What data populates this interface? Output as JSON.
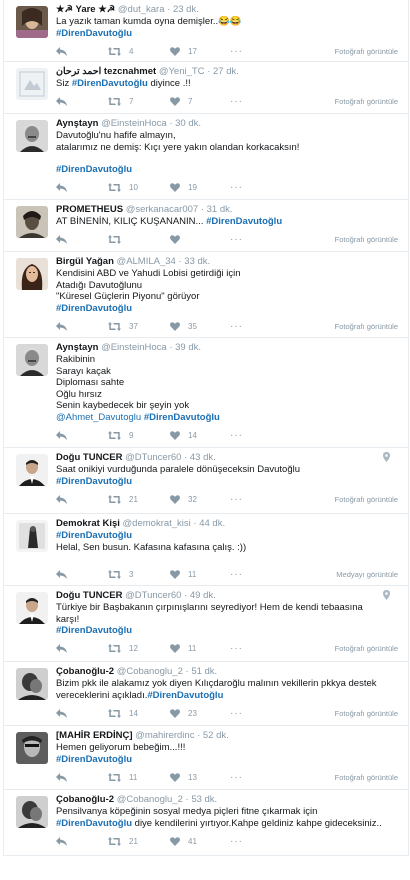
{
  "colors": {
    "accent": "#1b6fb3",
    "muted": "#8899a6",
    "text": "#14171a",
    "border": "#e6ecf0"
  },
  "tweets": [
    {
      "name": "★☭ Yare ★☭",
      "handle": "@dut_kara",
      "time": "· 23 dk.",
      "lines": [
        "La yazık taman kumda oyna demişler..😂😂"
      ],
      "tags": "#DirenDavutoğlu",
      "retweets": "4",
      "likes": "17",
      "media": "Fotoğrafı görüntüle",
      "avatar": "a1"
    },
    {
      "name": "احمد ترحان tezcnahmet",
      "handle": "@Yeni_TC",
      "time": "· 27 dk.",
      "lines_prefix": "Siz ",
      "inline_tag": "#DirenDavutoğlu",
      "lines_suffix": " diyince .!!",
      "retweets": "7",
      "likes": "7",
      "media": "Fotoğrafı görüntüle",
      "avatar": "a2"
    },
    {
      "name": "Aynştayn",
      "handle": "@EinsteinHoca",
      "time": "· 30 dk.",
      "lines": [
        "Davutoğlu'nu hafife almayın,",
        "atalarımız ne demiş: Kıçı yere yakın olandan korkacaksın!"
      ],
      "tags": "#DirenDavutoğlu",
      "retweets": "10",
      "likes": "19",
      "avatar": "a3"
    },
    {
      "name": "PROMETHEUS",
      "handle": "@serkanacar007",
      "time": "· 31 dk.",
      "lines_prefix": "AT BİNENİN, KILIÇ KUŞANANIN... ",
      "inline_tag": "#DirenDavutoğlu",
      "lines_suffix": "",
      "retweets": "",
      "likes": "",
      "media": "Fotoğrafı görüntüle",
      "avatar": "a4"
    },
    {
      "name": "Birgül Yağan",
      "handle": "@ALMILA_34",
      "time": "· 33 dk.",
      "lines": [
        "Kendisini ABD ve Yahudi Lobisi getirdiği için",
        "Atadığı Davutoğlunu",
        "\"Küresel Güçlerin Piyonu\" görüyor"
      ],
      "tags": "#DirenDavutoğlu",
      "retweets": "37",
      "likes": "35",
      "media": "Fotoğrafı görüntüle",
      "avatar": "a5"
    },
    {
      "name": "Aynştayn",
      "handle": "@EinsteinHoca",
      "time": "· 39 dk.",
      "lines": [
        "Rakibinin",
        "Sarayı kaçak",
        "Diploması sahte",
        "Oğlu hırsız",
        "Senin kaybedecek bir şeyin yok"
      ],
      "mention": "@Ahmet_Davutoglu",
      "tags": "#DirenDavutoğlu",
      "retweets": "9",
      "likes": "14",
      "avatar": "a3"
    },
    {
      "name": "Doğu TUNCER",
      "handle": "@DTuncer60",
      "time": "· 43 dk.",
      "lines": [
        "Saat onikiyi vurduğunda paralele dönüşeceksin Davutoğlu"
      ],
      "tags": "#DirenDavutoğlu",
      "retweets": "21",
      "likes": "32",
      "media": "Fotoğrafı görüntüle",
      "avatar": "a6"
    },
    {
      "name": "Demokrat Kişi",
      "handle": "@demokrat_kisi",
      "time": "· 44 dk.",
      "lines_first_tag": "#DirenDavutoğlu",
      "lines": [
        "Helal, Sen busun. Kafasına kafasına çalış. :))"
      ],
      "retweets": "3",
      "likes": "11",
      "media": "Medyayı görüntüle",
      "avatar": "a7"
    },
    {
      "name": "Doğu TUNCER",
      "handle": "@DTuncer60",
      "time": "· 49 dk.",
      "lines": [
        "Türkiye bir Başbakanın çırpınışlarını seyrediyor! Hem de kendi tebaasına",
        "karşı!"
      ],
      "tags": "#DirenDavutoğlu",
      "retweets": "12",
      "likes": "11",
      "media": "Fotoğrafı görüntüle",
      "avatar": "a6"
    },
    {
      "name": "Çobanoğlu-2",
      "handle": "@Cobanoglu_2",
      "time": "· 51 dk.",
      "lines": [
        "Bizim pkk ile alakamız yok diyen Kılıçdaroğlu malının vekillerin pkkya destek"
      ],
      "lines_prefix": "vereceklerini açıkladı.",
      "inline_tag": "#DirenDavutoğlu",
      "lines_suffix": "",
      "retweets": "14",
      "likes": "23",
      "media": "Fotoğrafı görüntüle",
      "avatar": "a8"
    },
    {
      "name": "[MAHİR ERDİNÇ]",
      "handle": "@mahirerdinc",
      "time": "· 52 dk.",
      "lines": [
        "Hemen geliyorum bebeğim...!!!"
      ],
      "tags": "#DirenDavutoğlu",
      "retweets": "11",
      "likes": "13",
      "media": "Fotoğrafı görüntüle",
      "avatar": "a9"
    },
    {
      "name": "Çobanoğlu-2",
      "handle": "@Cobanoglu_2",
      "time": "· 53 dk.",
      "lines": [
        "Pensilvanya köpeğinin sosyal medya piçleri fitne çıkarmak için"
      ],
      "lines_prefix": "",
      "inline_tag": "#DirenDavutoğlu",
      "lines_suffix": " diye kendilerini yırtıyor.Kahpe geldiniz kahpe gideceksiniz..",
      "retweets": "21",
      "likes": "41",
      "avatar": "a8"
    }
  ]
}
